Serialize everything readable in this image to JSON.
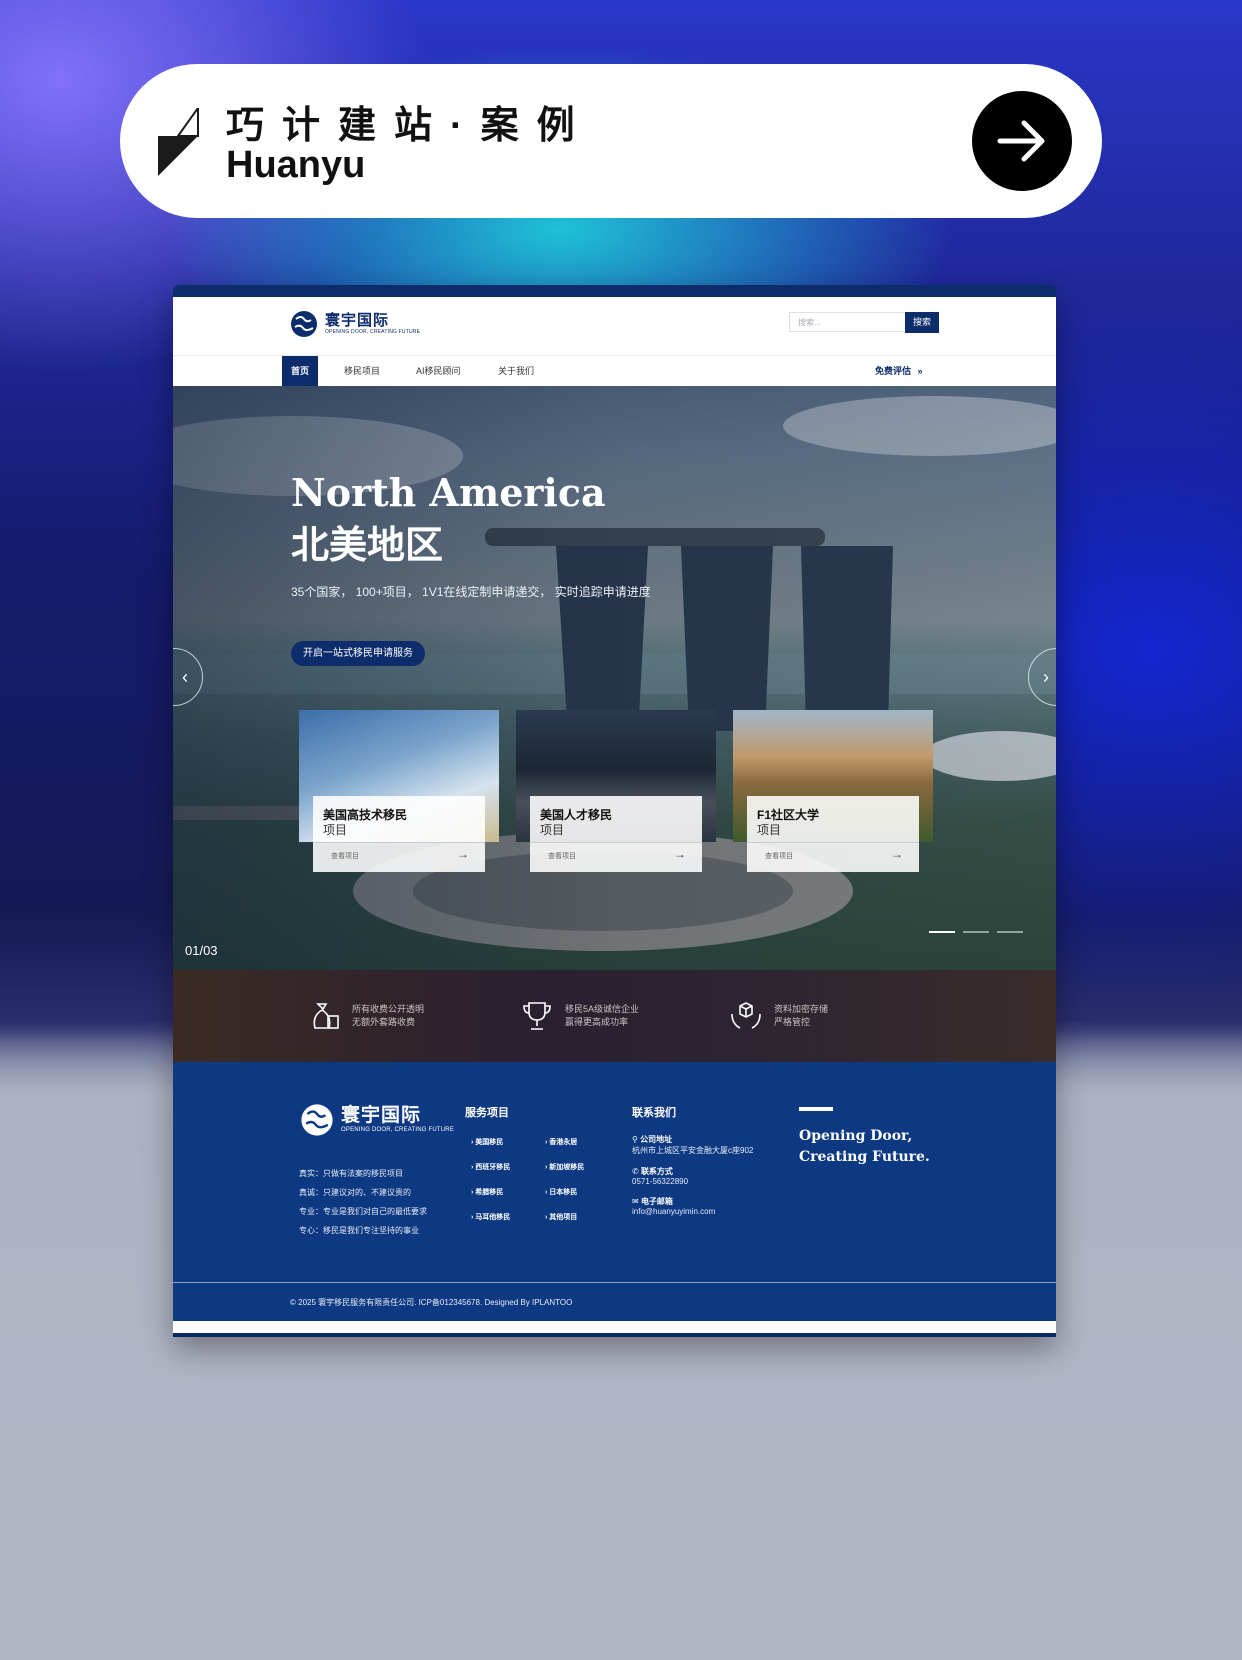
{
  "banner": {
    "title": "巧计建站·案例",
    "subtitle": "Huanyu",
    "arrow_icon": "arrow-right-icon"
  },
  "site": {
    "logo": {
      "cn": "寰宇国际",
      "en": "OPENING DOOR, CREATING FUTURE"
    },
    "search": {
      "placeholder": "搜索...",
      "button": "搜索"
    },
    "nav": {
      "items": [
        "首页",
        "移民项目",
        "AI移民顾问",
        "关于我们"
      ],
      "active": "首页",
      "cta": "免费评估",
      "cta_icon": "double-chevron-right-icon"
    },
    "hero": {
      "title_en": "North America",
      "title_cn": "北美地区",
      "description": "35个国家， 100+项目， 1V1在线定制申请递交， 实时追踪申请进度",
      "button": "开启一站式移民申请服务",
      "counter": "01/03",
      "slides_total": 3,
      "current_slide": 1,
      "cards": [
        {
          "title": "美国高技术移民",
          "subtitle": "项目",
          "link": "查看项目"
        },
        {
          "title": "美国人才移民",
          "subtitle": "项目",
          "link": "查看项目"
        },
        {
          "title": "F1社区大学",
          "subtitle": "项目",
          "link": "查看项目"
        }
      ]
    },
    "features": [
      {
        "icon": "money-bag-icon",
        "line1": "所有收费公开透明",
        "line2": "无额外套路收费"
      },
      {
        "icon": "trophy-icon",
        "line1": "移民5A级诚信企业",
        "line2": "赢得更高成功率"
      },
      {
        "icon": "secure-box-hands-icon",
        "line1": "资料加密存储",
        "line2": "严格管控"
      }
    ],
    "footer": {
      "logo": {
        "cn": "寰宇国际",
        "en": "OPENING DOOR, CREATING FUTURE"
      },
      "mottos": [
        "真实：只做有法案的移民项目",
        "真诚：只建议对的、不建议贵的",
        "专业：专业是我们对自己的最低要求",
        "专心：移民是我们专注坚持的事业"
      ],
      "services_title": "服务项目",
      "services": [
        "美国移民",
        "香港永居",
        "西班牙移民",
        "新加坡移民",
        "希腊移民",
        "日本移民",
        "马耳他移民",
        "其他项目"
      ],
      "contact_title": "联系我们",
      "contact": [
        {
          "label": "公司地址",
          "value": "杭州市上城区平安金融大厦c座902",
          "icon": "location-pin-icon"
        },
        {
          "label": "联系方式",
          "value": "0571-56322890",
          "icon": "phone-icon"
        },
        {
          "label": "电子邮箱",
          "value": "info@huanyuyimin.com",
          "icon": "mail-icon"
        }
      ],
      "slogan_line1": "Opening Door,",
      "slogan_line2": "Creating Future.",
      "copyright": "© 2025 寰宇移民服务有限责任公司. ICP备012345678. Designed By IPLANTOO"
    }
  },
  "colors": {
    "brand_navy": "#0d2c6b",
    "footer_blue": "#0d3882"
  }
}
